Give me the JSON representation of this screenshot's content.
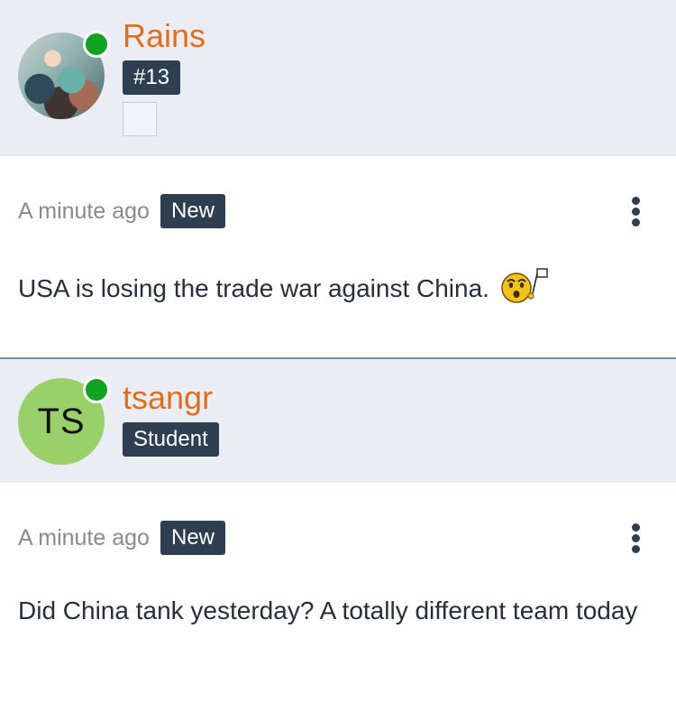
{
  "posts": [
    {
      "author": "Rains",
      "badge": "#13",
      "avatar": "photo",
      "online": true,
      "time": "A minute ago",
      "status_badge": "New",
      "text": "USA is losing the trade war against China.",
      "emoji": "shocked-face-with-flag"
    },
    {
      "author": "tsangr",
      "badge": "Student",
      "avatar_initials": "TS",
      "online": true,
      "time": "A minute ago",
      "status_badge": "New",
      "text": "Did China tank yesterday? A totally different team today"
    }
  ],
  "colors": {
    "header_bg": "#eaeef4",
    "username": "#e36d1b",
    "badge_bg": "#2f3f52",
    "online": "#11a321",
    "initials_avatar_bg": "#9ad069",
    "divider": "#6f8fae"
  }
}
